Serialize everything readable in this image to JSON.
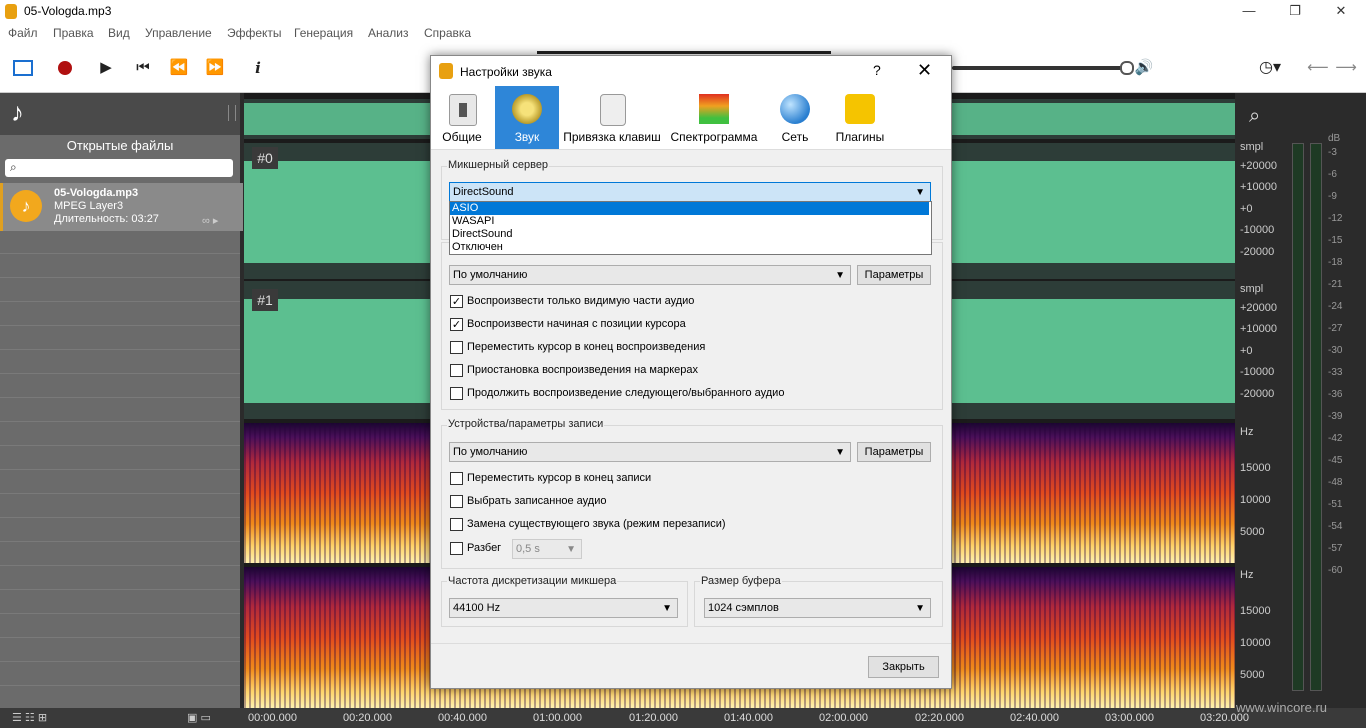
{
  "window": {
    "title": "05-Vologda.mp3"
  },
  "menu": [
    "Файл",
    "Правка",
    "Вид",
    "Управление",
    "Эффекты",
    "Генерация",
    "Анализ",
    "Справка"
  ],
  "left_panel": {
    "title": "Открытые файлы",
    "search_placeholder": "",
    "file": {
      "name": "05-Vologda.mp3",
      "type": "MPEG Layer3",
      "duration": "Длительность: 03:27"
    }
  },
  "channels": [
    "#0",
    "#1"
  ],
  "right_scale": {
    "wave_unit": "smpl",
    "wave_ticks": [
      "+20000",
      "+10000",
      "+0",
      "-10000",
      "-20000"
    ],
    "spec_unit": "Hz",
    "spec_ticks": [
      "15000",
      "10000",
      "5000"
    ],
    "db_unit": "dB",
    "db_ticks": [
      "-3",
      "-6",
      "-9",
      "-12",
      "-15",
      "-18",
      "-21",
      "-24",
      "-27",
      "-30",
      "-33",
      "-36",
      "-39",
      "-42",
      "-45",
      "-48",
      "-51",
      "-54",
      "-57",
      "-60"
    ]
  },
  "timeline": [
    "00:00.000",
    "00:20.000",
    "00:40.000",
    "01:00.000",
    "01:20.000",
    "01:40.000",
    "02:00.000",
    "02:20.000",
    "02:40.000",
    "03:00.000",
    "03:20.000"
  ],
  "watermark": "www.wincore.ru",
  "dialog": {
    "title": "Настройки звука",
    "help": "?",
    "close": "✕",
    "tabs": [
      {
        "label": "Общие",
        "icon": "switch-icon"
      },
      {
        "label": "Звук",
        "icon": "speaker-icon"
      },
      {
        "label": "Привязка клавиш",
        "icon": "keyboard-key-icon"
      },
      {
        "label": "Спектрограмма",
        "icon": "spectrogram-icon"
      },
      {
        "label": "Сеть",
        "icon": "globe-icon"
      },
      {
        "label": "Плагины",
        "icon": "plugin-icon"
      }
    ],
    "mixer_group": {
      "title": "Микшерный сервер",
      "selected": "DirectSound",
      "options": [
        "ASIO",
        "WASAPI",
        "DirectSound",
        "Отключен"
      ],
      "highlighted": "ASIO"
    },
    "playback": {
      "device": "По умолчанию",
      "params_button": "Параметры",
      "checkboxes": [
        {
          "label": "Воспроизвести только видимую части аудио",
          "checked": true
        },
        {
          "label": "Воспроизвести начиная с позиции курсора",
          "checked": true
        },
        {
          "label": "Переместить курсор в конец воспроизведения",
          "checked": false
        },
        {
          "label": "Приостановка воспроизведения на маркерах",
          "checked": false
        },
        {
          "label": "Продолжить воспроизведение следующего/выбранного аудио",
          "checked": false
        }
      ]
    },
    "recording": {
      "title": "Устройства/параметры записи",
      "device": "По умолчанию",
      "params_button": "Параметры",
      "checkboxes": [
        {
          "label": "Переместить курсор в конец записи",
          "checked": false
        },
        {
          "label": "Выбрать записанное аудио",
          "checked": false
        },
        {
          "label": "Замена существующего звука (режим перезаписи)",
          "checked": false
        },
        {
          "label": "Разбег",
          "checked": false
        }
      ],
      "preroll_value": "0,5 s"
    },
    "sample_rate": {
      "title": "Частота дискретизации микшера",
      "value": "44100 Hz"
    },
    "buffer": {
      "title": "Размер буфера",
      "value": "1024 сэмплов"
    },
    "close_button": "Закрыть"
  }
}
